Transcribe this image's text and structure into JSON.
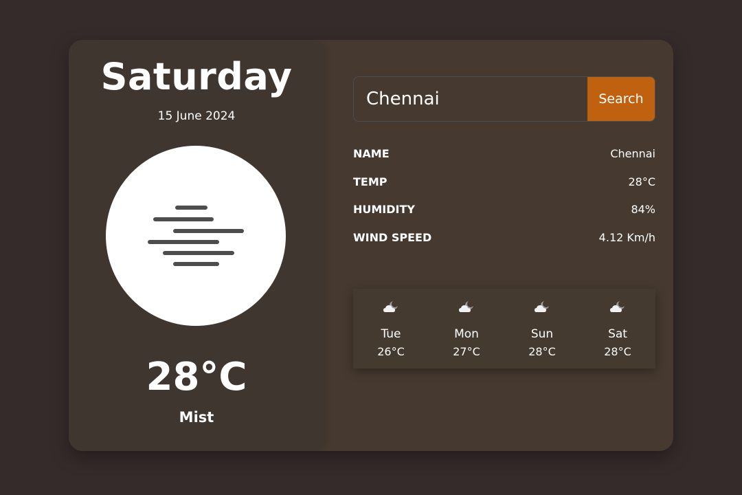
{
  "current": {
    "day": "Saturday",
    "date": "15 June 2024",
    "temperature": "28°C",
    "condition": "Mist",
    "icon": "mist-icon"
  },
  "search": {
    "value": "Chennai",
    "button_label": "Search"
  },
  "details": [
    {
      "label": "NAME",
      "value": "Chennai"
    },
    {
      "label": "TEMP",
      "value": "28°C"
    },
    {
      "label": "HUMIDITY",
      "value": "84%"
    },
    {
      "label": "WIND SPEED",
      "value": "4.12 Km/h"
    }
  ],
  "forecast": [
    {
      "day": "Tue",
      "temp": "26°C",
      "icon": "cloudy-night-icon"
    },
    {
      "day": "Mon",
      "temp": "27°C",
      "icon": "cloudy-night-icon"
    },
    {
      "day": "Sun",
      "temp": "28°C",
      "icon": "cloudy-night-icon"
    },
    {
      "day": "Sat",
      "temp": "28°C",
      "icon": "cloudy-night-icon"
    }
  ],
  "colors": {
    "background": "#362b2b",
    "card": "#463a30",
    "left_panel": "#3f362f",
    "accent": "#c0610f",
    "text": "#ffffff"
  }
}
